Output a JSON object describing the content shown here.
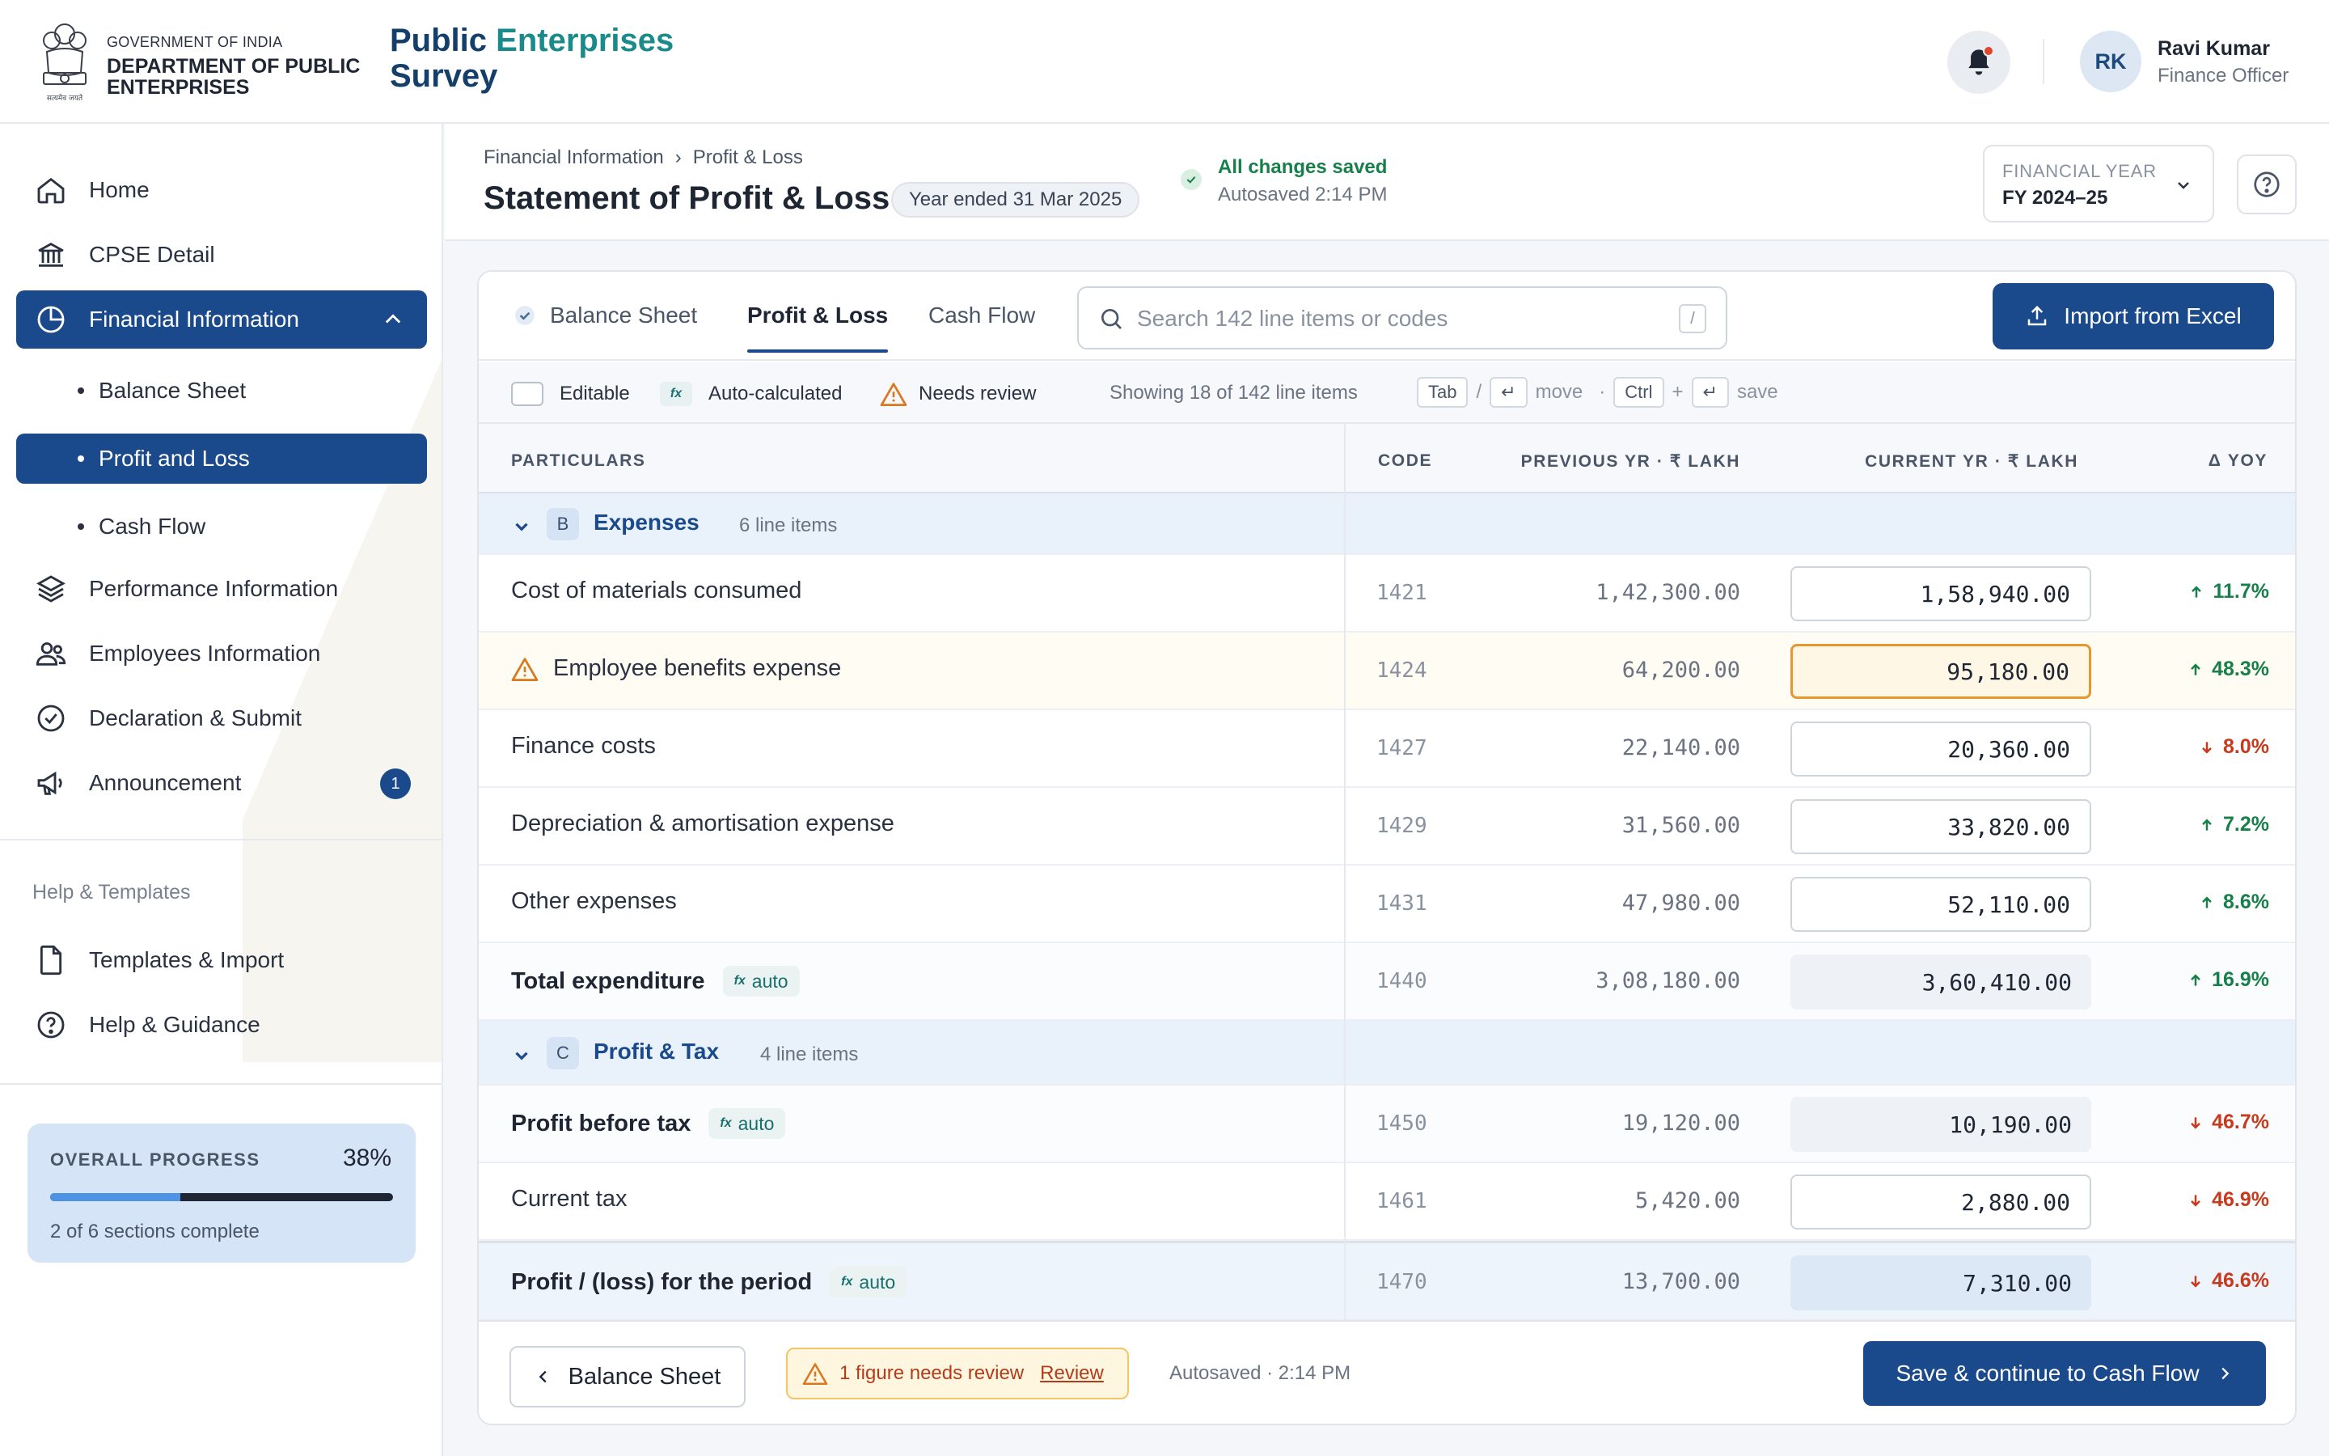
{
  "header": {
    "gov_line1": "GOVERNMENT OF INDIA",
    "dept_name": "DEPARTMENT OF PUBLIC ENTERPRISES",
    "emblem_caption": "सत्यमेव जयते",
    "brand_part1": "Public ",
    "brand_part2": "Enterprises",
    "brand_part3": "Survey",
    "user_initials": "RK",
    "user_name": "Ravi Kumar",
    "user_role": "Finance Officer"
  },
  "sidebar": {
    "nav": [
      {
        "label": "Home",
        "icon": "home-icon"
      },
      {
        "label": "CPSE Detail",
        "icon": "bank-icon"
      },
      {
        "label": "Financial Information",
        "icon": "pie-chart-icon",
        "active": true
      },
      {
        "label": "Performance Information",
        "icon": "layers-icon"
      },
      {
        "label": "Employees Information",
        "icon": "users-icon"
      },
      {
        "label": "Declaration & Submit",
        "icon": "check-circle-icon"
      },
      {
        "label": "Announcement",
        "icon": "megaphone-icon",
        "badge": "1"
      }
    ],
    "sub": [
      {
        "label": "Balance Sheet"
      },
      {
        "label": "Profit and Loss",
        "active": true
      },
      {
        "label": "Cash Flow"
      }
    ],
    "help_heading": "Help & Templates",
    "help_items": [
      {
        "label": "Templates & Import",
        "icon": "file-icon"
      },
      {
        "label": "Help & Guidance",
        "icon": "help-circle-icon"
      }
    ],
    "progress": {
      "label": "OVERALL PROGRESS",
      "percent_text": "38%",
      "fraction": 0.38,
      "summary": "2 of 6 sections complete"
    }
  },
  "page": {
    "breadcrumb": [
      "Financial Information",
      "Profit & Loss"
    ],
    "breadcrumb_sep": "›",
    "title": "Statement of Profit & Loss",
    "year_pill": "Year ended 31 Mar 2025",
    "save_status": "All changes saved",
    "autosave_text": "Autosaved 2:14 PM",
    "fy_label": "FINANCIAL YEAR",
    "fy_value": "FY 2024–25"
  },
  "tabs": [
    {
      "label": "Balance Sheet",
      "done": true
    },
    {
      "label": "Profit & Loss",
      "active": true
    },
    {
      "label": "Cash Flow"
    }
  ],
  "search": {
    "placeholder": "Search 142 line items or codes",
    "shortcut": "/"
  },
  "import_label": "Import from Excel",
  "legend": {
    "editable": "Editable",
    "fx": "fx",
    "auto_calc": "Auto-calculated",
    "needs_review": "Needs review",
    "showing": "Showing 18 of 142 line items",
    "k_tab": "Tab",
    "slash": "/",
    "enter": "↵",
    "move": "move",
    "dot": "·",
    "k_ctrl": "Ctrl",
    "plus": "+",
    "save": "save"
  },
  "table": {
    "headers": {
      "particulars": "PARTICULARS",
      "code": "CODE",
      "prev": "PREVIOUS YR · ₹ LAKH",
      "curr": "CURRENT YR · ₹ LAKH",
      "yoy": "Δ YOY"
    },
    "auto_label": "auto",
    "groups": [
      {
        "letter": "B",
        "name": "Expenses",
        "count": "6 line items"
      },
      {
        "letter": "C",
        "name": "Profit & Tax",
        "count": "4 line items"
      }
    ],
    "rows": [
      {
        "name": "Cost of materials consumed",
        "code": "1421",
        "prev": "1,42,300.00",
        "curr": "1,58,940.00",
        "yoy": "11.7%",
        "dir": "up"
      },
      {
        "name": "Employee benefits expense",
        "code": "1424",
        "prev": "64,200.00",
        "curr": "95,180.00",
        "yoy": "48.3%",
        "dir": "up",
        "review": true
      },
      {
        "name": "Finance costs",
        "code": "1427",
        "prev": "22,140.00",
        "curr": "20,360.00",
        "yoy": "8.0%",
        "dir": "down"
      },
      {
        "name": "Depreciation & amortisation expense",
        "code": "1429",
        "prev": "31,560.00",
        "curr": "33,820.00",
        "yoy": "7.2%",
        "dir": "up"
      },
      {
        "name": "Other expenses",
        "code": "1431",
        "prev": "47,980.00",
        "curr": "52,110.00",
        "yoy": "8.6%",
        "dir": "up"
      },
      {
        "name": "Total expenditure",
        "code": "1440",
        "prev": "3,08,180.00",
        "curr": "3,60,410.00",
        "yoy": "16.9%",
        "dir": "up",
        "auto": true
      },
      {
        "name": "Profit before tax",
        "code": "1450",
        "prev": "19,120.00",
        "curr": "10,190.00",
        "yoy": "46.7%",
        "dir": "down",
        "auto": true
      },
      {
        "name": "Current tax",
        "code": "1461",
        "prev": "5,420.00",
        "curr": "2,880.00",
        "yoy": "46.9%",
        "dir": "down"
      },
      {
        "name": "Profit / (loss) for the period",
        "code": "1470",
        "prev": "13,700.00",
        "curr": "7,310.00",
        "yoy": "46.6%",
        "dir": "down",
        "auto": true,
        "total": true
      }
    ]
  },
  "footer": {
    "back_label": "Balance Sheet",
    "review_text": "1 figure needs review",
    "review_link": "Review",
    "autosaved": "Autosaved · 2:14 PM",
    "next_label": "Save & continue to Cash Flow"
  },
  "colors": {
    "primary": "#1b4a8c",
    "teal": "#1a8a8a",
    "up": "#17804a",
    "down": "#c73a1e",
    "warn": "#e8962e"
  }
}
